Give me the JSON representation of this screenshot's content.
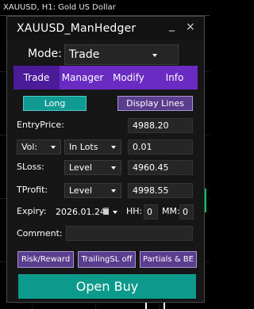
{
  "chart_window": {
    "title": "XAUUSD, H1:  Gold US Dollar"
  },
  "panel": {
    "title": "XAUUSD_ManHedger",
    "minimize_glyph": "_",
    "close_glyph": "×",
    "mode": {
      "label": "Mode:",
      "value": "Trade"
    },
    "tabs": [
      {
        "label": "Trade",
        "active": true
      },
      {
        "label": "Manager",
        "active": false
      },
      {
        "label": "Modify",
        "active": false
      },
      {
        "label": "Info",
        "active": false
      }
    ],
    "long_button": "Long",
    "display_lines_button": "Display Lines",
    "entry": {
      "label": "EntryPrice:",
      "value": "4988.20"
    },
    "volume": {
      "label": "Vol:",
      "mode": "In Lots",
      "value": "0.01"
    },
    "sloss": {
      "label": "SLoss:",
      "mode": "Level",
      "value": "4960.45"
    },
    "tprofit": {
      "label": "TProfit:",
      "mode": "Level",
      "value": "4998.55"
    },
    "expiry": {
      "label": "Expiry:",
      "date": "2026.01.24",
      "hh_label": "HH:",
      "hh": "0",
      "mm_label": "MM:",
      "mm": "0"
    },
    "comment": {
      "label": "Comment:",
      "value": ""
    },
    "risk_reward_button": "Risk/Reward",
    "trailing_button": "TrailingSL off",
    "partials_button": "Partials & BE",
    "open_button": "Open Buy"
  },
  "colors": {
    "tab_bar": "#6a2bc2",
    "tab_active": "#4b1b99",
    "long": "#0f9a93",
    "secondary_button": "#5a3d8e",
    "open_buy": "#0c9a8d"
  }
}
